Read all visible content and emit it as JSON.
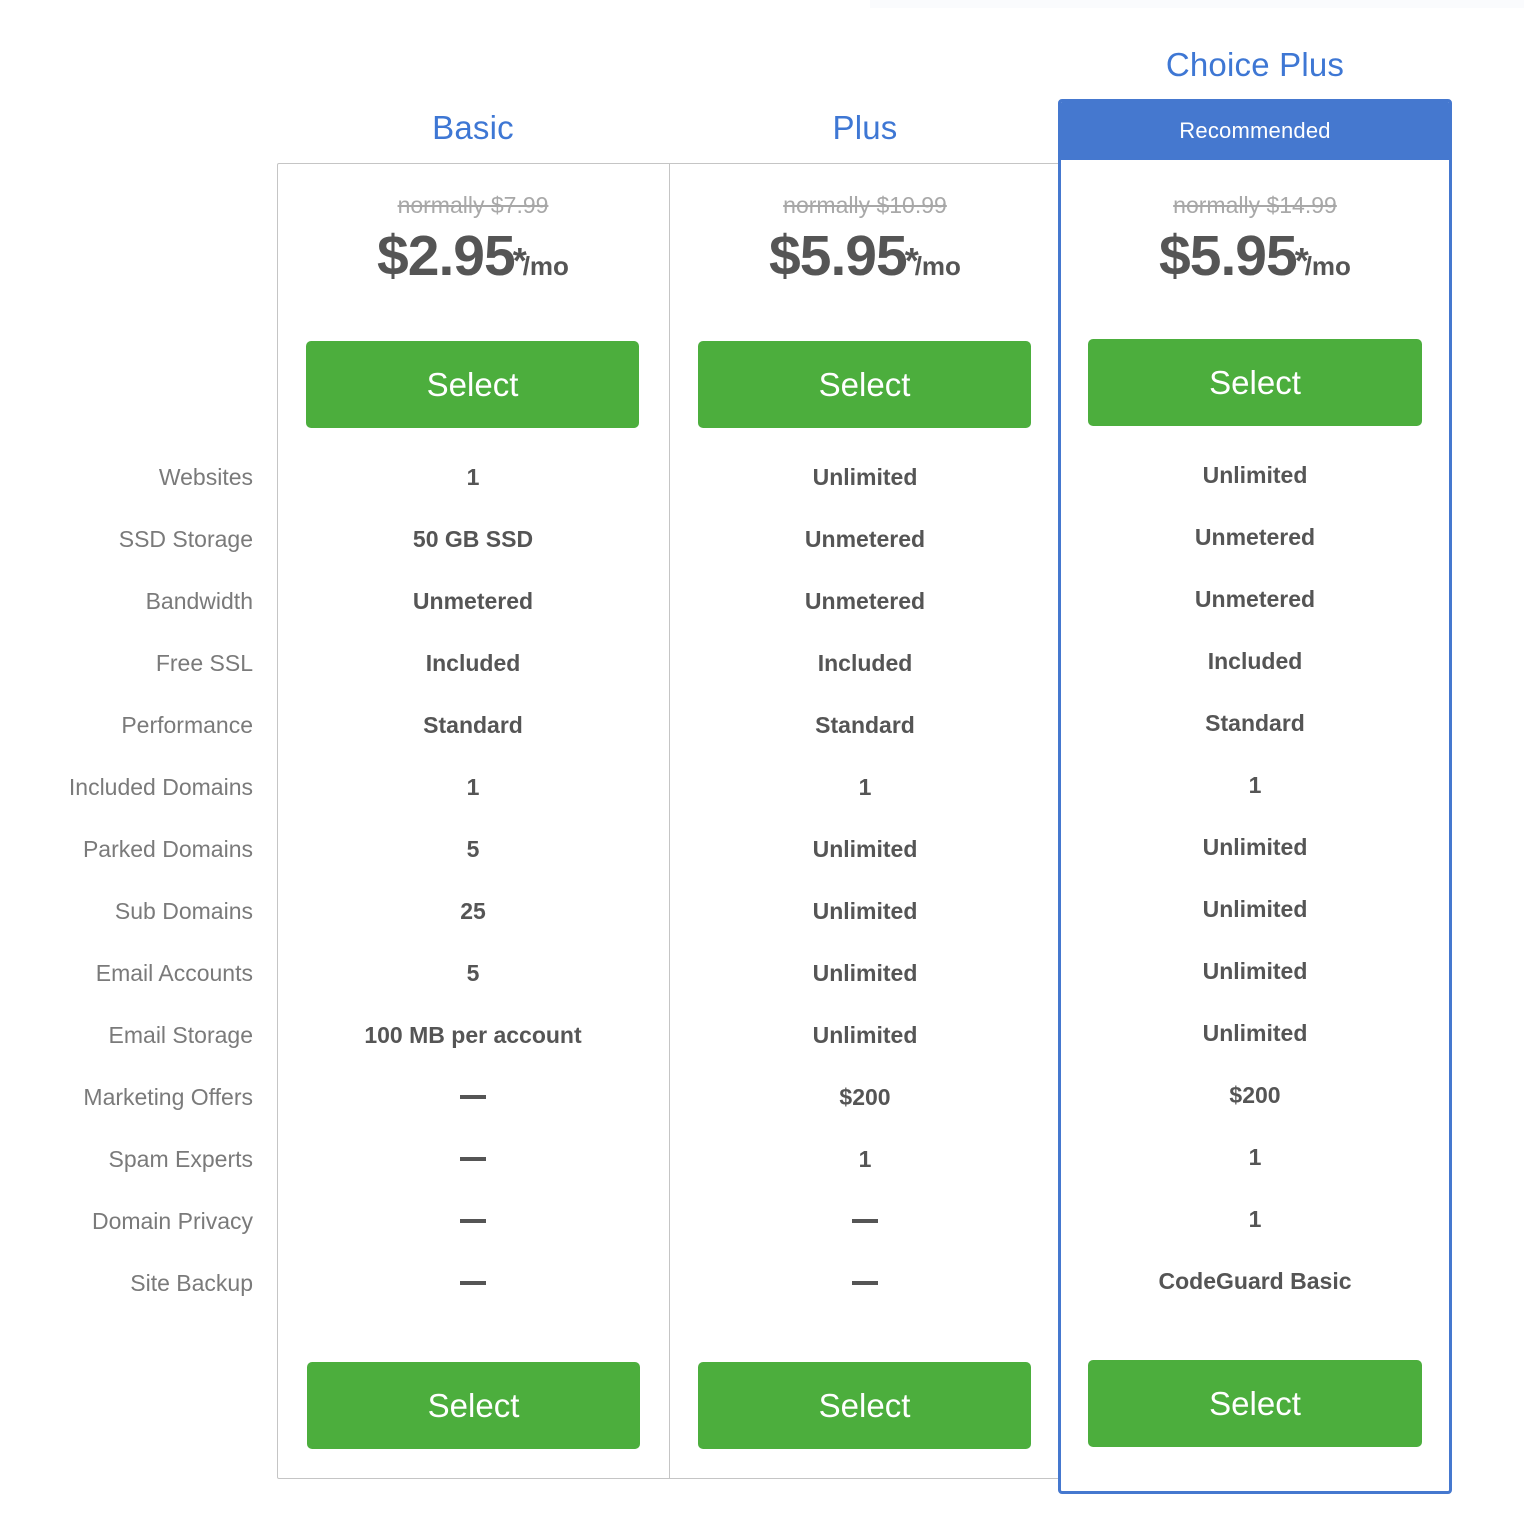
{
  "colors": {
    "accent_blue": "#4578cf",
    "title_blue": "#3e77d4",
    "button_green": "#4cae3d",
    "text_dark": "#555555",
    "label_grey": "#7a7a7a",
    "strike_grey": "#a8a8a8",
    "card_border": "#c5c5c5"
  },
  "plans": [
    {
      "name": "Basic",
      "badge": "",
      "normal_price": "normally $7.99",
      "price": "$2.95",
      "star": "*",
      "per": "/mo",
      "select_top_label": "Select",
      "select_bottom_label": "Select"
    },
    {
      "name": "Plus",
      "badge": "",
      "normal_price": "normally $10.99",
      "price": "$5.95",
      "star": "*",
      "per": "/mo",
      "select_top_label": "Select",
      "select_bottom_label": "Select"
    },
    {
      "name": "Choice Plus",
      "badge": "Recommended",
      "normal_price": "normally $14.99",
      "price": "$5.95",
      "star": "*",
      "per": "/mo",
      "select_top_label": "Select",
      "select_bottom_label": "Select"
    }
  ],
  "features": [
    {
      "label": "Websites",
      "values": [
        "1",
        "Unlimited",
        "Unlimited"
      ]
    },
    {
      "label": "SSD Storage",
      "values": [
        "50 GB SSD",
        "Unmetered",
        "Unmetered"
      ]
    },
    {
      "label": "Bandwidth",
      "values": [
        "Unmetered",
        "Unmetered",
        "Unmetered"
      ]
    },
    {
      "label": "Free SSL",
      "values": [
        "Included",
        "Included",
        "Included"
      ]
    },
    {
      "label": "Performance",
      "values": [
        "Standard",
        "Standard",
        "Standard"
      ]
    },
    {
      "label": "Included Domains",
      "values": [
        "1",
        "1",
        "1"
      ]
    },
    {
      "label": "Parked Domains",
      "values": [
        "5",
        "Unlimited",
        "Unlimited"
      ]
    },
    {
      "label": "Sub Domains",
      "values": [
        "25",
        "Unlimited",
        "Unlimited"
      ]
    },
    {
      "label": "Email Accounts",
      "values": [
        "5",
        "Unlimited",
        "Unlimited"
      ]
    },
    {
      "label": "Email Storage",
      "values": [
        "100 MB per account",
        "Unlimited",
        "Unlimited"
      ]
    },
    {
      "label": "Marketing Offers",
      "values": [
        "—",
        "$200",
        "$200"
      ]
    },
    {
      "label": "Spam Experts",
      "values": [
        "—",
        "1",
        "1"
      ]
    },
    {
      "label": "Domain Privacy",
      "values": [
        "—",
        "—",
        "1"
      ]
    },
    {
      "label": "Site Backup",
      "values": [
        "—",
        "—",
        "CodeGuard Basic"
      ]
    }
  ]
}
